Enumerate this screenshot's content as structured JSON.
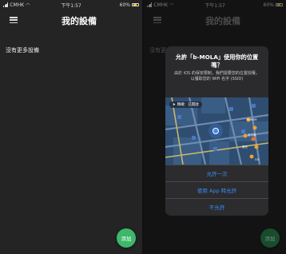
{
  "status": {
    "carrier": "CMHK",
    "time": "下午1:57",
    "battery": "60%"
  },
  "appbar": {
    "title": "我的設備"
  },
  "main": {
    "empty_text": "沒有更多設備"
  },
  "fab": {
    "label": "添加"
  },
  "dialog": {
    "title": "允許「b-MOLA」使用你的位置嗎？",
    "message": "由於 iOS 的保安限制，我們需要您的位置授權，以獲取您的 WiFi 名字 (SSID)",
    "precise_label": "精確：已開啟",
    "buttons": {
      "allow_once": "允許一次",
      "allow_while_using": "使用 App 時允許",
      "deny": "不允許"
    },
    "map_labels": [
      "POKEM",
      "地下道",
      "燈光",
      "OO"
    ]
  },
  "colors": {
    "background": "#242424",
    "accent_green": "#3db86a",
    "ios_blue": "#3a8ef5",
    "battery_yellow": "#f0c000"
  }
}
